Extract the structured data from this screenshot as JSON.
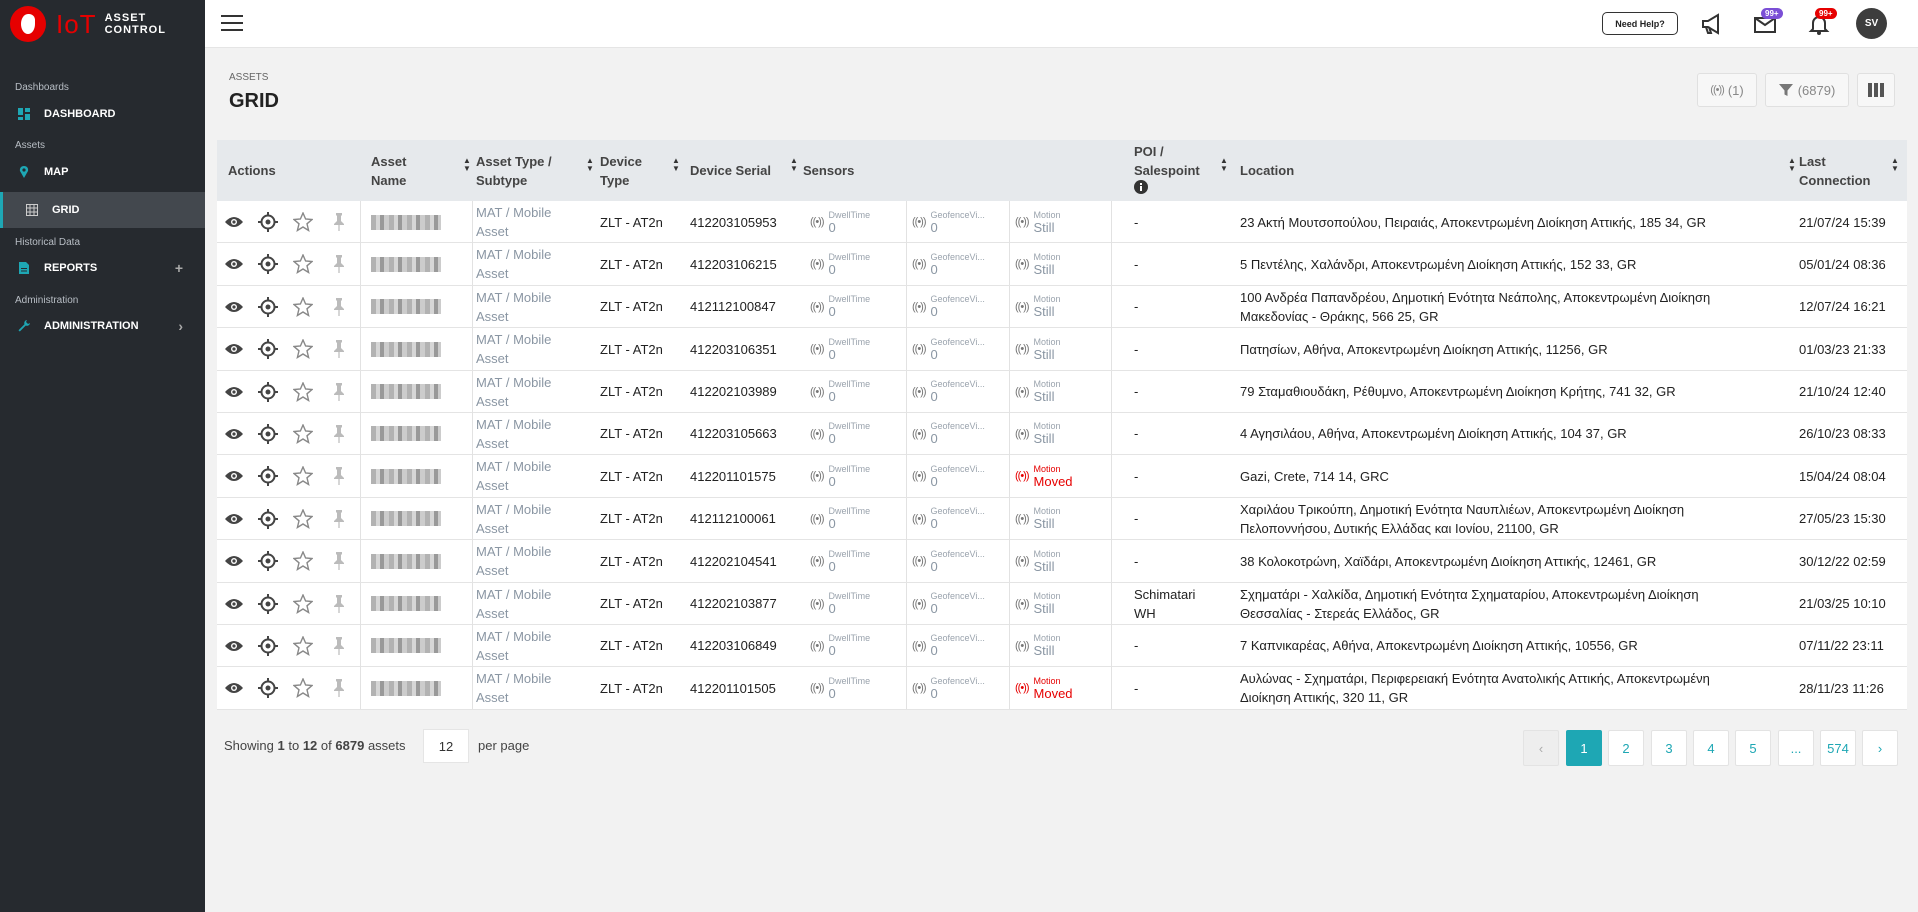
{
  "brand": {
    "iot": "IoT",
    "asset": "ASSET",
    "control": "CONTROL"
  },
  "sidebar": {
    "sections": [
      "Dashboards",
      "Assets",
      "Historical Data",
      "Administration"
    ],
    "items": [
      {
        "label": "DASHBOARD",
        "icon": "dashboard-icon"
      },
      {
        "label": "MAP",
        "icon": "map-pin-icon"
      },
      {
        "label": "GRID",
        "icon": "grid-icon"
      },
      {
        "label": "REPORTS",
        "icon": "report-icon",
        "trail": "+"
      },
      {
        "label": "ADMINISTRATION",
        "icon": "wrench-icon",
        "trail": "›"
      }
    ]
  },
  "topbar": {
    "need_help": "Need Help?",
    "mail_badge": "99+",
    "bell_badge": "99+",
    "avatar": "SV"
  },
  "page": {
    "breadcrumb": "ASSETS",
    "title": "GRID",
    "sensor_count": "(1)",
    "filter_count": "(6879)"
  },
  "columns": {
    "actions": "Actions",
    "asset_name_1": "Asset",
    "asset_name_2": "Name",
    "asset_type_1": "Asset Type /",
    "asset_type_2": "Subtype",
    "device_type_1": "Device",
    "device_type_2": "Type",
    "device_serial": "Device Serial",
    "sensors": "Sensors",
    "poi_1": "POI /",
    "poi_2": "Salespoint",
    "location": "Location",
    "last_conn_1": "Last",
    "last_conn_2": "Connection"
  },
  "rows": [
    {
      "type1": "MAT / Mobile",
      "type2": "Asset",
      "device": "ZLT - AT2n",
      "serial": "412203105953",
      "dwell_label": "DwellTime",
      "dwell": "0",
      "geo_label": "GeofenceVi...",
      "geo": "0",
      "motion_label": "Motion",
      "motion": "Still",
      "poi1": "-",
      "poi2": "",
      "loc1": "23 Ακτή Μουτσοπούλου, Πειραιάς, Αποκεντρωμένη Διοίκηση Αττικής, 185 34, GR",
      "loc2": "",
      "last": "21/07/24 15:39"
    },
    {
      "type1": "MAT / Mobile",
      "type2": "Asset",
      "device": "ZLT - AT2n",
      "serial": "412203106215",
      "dwell_label": "DwellTime",
      "dwell": "0",
      "geo_label": "GeofenceVi...",
      "geo": "0",
      "motion_label": "Motion",
      "motion": "Still",
      "poi1": "-",
      "poi2": "",
      "loc1": "5 Πεντέλης, Χαλάνδρι, Αποκεντρωμένη Διοίκηση Αττικής, 152 33, GR",
      "loc2": "",
      "last": "05/01/24 08:36"
    },
    {
      "type1": "MAT / Mobile",
      "type2": "Asset",
      "device": "ZLT - AT2n",
      "serial": "412112100847",
      "dwell_label": "DwellTime",
      "dwell": "0",
      "geo_label": "GeofenceVi...",
      "geo": "0",
      "motion_label": "Motion",
      "motion": "Still",
      "poi1": "-",
      "poi2": "",
      "loc1": "100 Ανδρέα Παπανδρέου, Δημοτική Ενότητα Νεάπολης, Αποκεντρωμένη Διοίκηση",
      "loc2": "Μακεδονίας - Θράκης, 566 25, GR",
      "last": "12/07/24 16:21"
    },
    {
      "type1": "MAT / Mobile",
      "type2": "Asset",
      "device": "ZLT - AT2n",
      "serial": "412203106351",
      "dwell_label": "DwellTime",
      "dwell": "0",
      "geo_label": "GeofenceVi...",
      "geo": "0",
      "motion_label": "Motion",
      "motion": "Still",
      "poi1": "-",
      "poi2": "",
      "loc1": "Πατησίων, Αθήνα, Αποκεντρωμένη Διοίκηση Αττικής, 11256, GR",
      "loc2": "",
      "last": "01/03/23 21:33"
    },
    {
      "type1": "MAT / Mobile",
      "type2": "Asset",
      "device": "ZLT - AT2n",
      "serial": "412202103989",
      "dwell_label": "DwellTime",
      "dwell": "0",
      "geo_label": "GeofenceVi...",
      "geo": "0",
      "motion_label": "Motion",
      "motion": "Still",
      "poi1": "-",
      "poi2": "",
      "loc1": "79 Σταμαθιουδάκη, Ρέθυμνο, Αποκεντρωμένη Διοίκηση Κρήτης, 741 32, GR",
      "loc2": "",
      "last": "21/10/24 12:40"
    },
    {
      "type1": "MAT / Mobile",
      "type2": "Asset",
      "device": "ZLT - AT2n",
      "serial": "412203105663",
      "dwell_label": "DwellTime",
      "dwell": "0",
      "geo_label": "GeofenceVi...",
      "geo": "0",
      "motion_label": "Motion",
      "motion": "Still",
      "poi1": "-",
      "poi2": "",
      "loc1": "4 Αγησιλάου, Αθήνα, Αποκεντρωμένη Διοίκηση Αττικής, 104 37, GR",
      "loc2": "",
      "last": "26/10/23 08:33"
    },
    {
      "type1": "MAT / Mobile",
      "type2": "Asset",
      "device": "ZLT - AT2n",
      "serial": "412201101575",
      "dwell_label": "DwellTime",
      "dwell": "0",
      "geo_label": "GeofenceVi...",
      "geo": "0",
      "motion_label": "Motion",
      "motion": "Moved",
      "poi1": "-",
      "poi2": "",
      "loc1": "Gazi, Crete, 714 14, GRC",
      "loc2": "",
      "last": "15/04/24 08:04"
    },
    {
      "type1": "MAT / Mobile",
      "type2": "Asset",
      "device": "ZLT - AT2n",
      "serial": "412112100061",
      "dwell_label": "DwellTime",
      "dwell": "0",
      "geo_label": "GeofenceVi...",
      "geo": "0",
      "motion_label": "Motion",
      "motion": "Still",
      "poi1": "-",
      "poi2": "",
      "loc1": "Χαριλάου Τρικούπη, Δημοτική Ενότητα Ναυπλιέων, Αποκεντρωμένη Διοίκηση",
      "loc2": "Πελοποννήσου, Δυτικής Ελλάδας και Ιονίου, 21100, GR",
      "last": "27/05/23 15:30"
    },
    {
      "type1": "MAT / Mobile",
      "type2": "Asset",
      "device": "ZLT - AT2n",
      "serial": "412202104541",
      "dwell_label": "DwellTime",
      "dwell": "0",
      "geo_label": "GeofenceVi...",
      "geo": "0",
      "motion_label": "Motion",
      "motion": "Still",
      "poi1": "-",
      "poi2": "",
      "loc1": "38 Κολοκοτρώνη, Χαϊδάρι, Αποκεντρωμένη Διοίκηση Αττικής, 12461, GR",
      "loc2": "",
      "last": "30/12/22 02:59"
    },
    {
      "type1": "MAT / Mobile",
      "type2": "Asset",
      "device": "ZLT - AT2n",
      "serial": "412202103877",
      "dwell_label": "DwellTime",
      "dwell": "0",
      "geo_label": "GeofenceVi...",
      "geo": "0",
      "motion_label": "Motion",
      "motion": "Still",
      "poi1": "Schimatari",
      "poi2": "WH",
      "loc1": "Σχηματάρι - Χαλκίδα, Δημοτική Ενότητα Σχηματαρίου, Αποκεντρωμένη Διοίκηση",
      "loc2": "Θεσσαλίας - Στερεάς Ελλάδος, GR",
      "last": "21/03/25 10:10"
    },
    {
      "type1": "MAT / Mobile",
      "type2": "Asset",
      "device": "ZLT - AT2n",
      "serial": "412203106849",
      "dwell_label": "DwellTime",
      "dwell": "0",
      "geo_label": "GeofenceVi...",
      "geo": "0",
      "motion_label": "Motion",
      "motion": "Still",
      "poi1": "-",
      "poi2": "",
      "loc1": "7 Καπνικαρέας, Αθήνα, Αποκεντρωμένη Διοίκηση Αττικής, 10556, GR",
      "loc2": "",
      "last": "07/11/22 23:11"
    },
    {
      "type1": "MAT / Mobile",
      "type2": "Asset",
      "device": "ZLT - AT2n",
      "serial": "412201101505",
      "dwell_label": "DwellTime",
      "dwell": "0",
      "geo_label": "GeofenceVi...",
      "geo": "0",
      "motion_label": "Motion",
      "motion": "Moved",
      "poi1": "-",
      "poi2": "",
      "loc1": "Αυλώνας - Σχηματάρι, Περιφερειακή Ενότητα Ανατολικής Αττικής, Αποκεντρωμένη",
      "loc2": "Διοίκηση Αττικής, 320 11, GR",
      "last": "28/11/23 11:26"
    }
  ],
  "footer": {
    "showing": "Showing",
    "from": "1",
    "to_word": "to",
    "to": "12",
    "of_word": "of",
    "total": "6879",
    "assets_word": "assets",
    "per_page_value": "12",
    "per_page_label": "per page"
  },
  "pagination": {
    "prev": "‹",
    "pages": [
      "1",
      "2",
      "3",
      "4",
      "5",
      "...",
      "574"
    ],
    "next": "›"
  },
  "colors": {
    "accent": "#1ea7b4",
    "brand_red": "#e60000",
    "sidebar_bg": "#262a2f",
    "badge_purple": "#7b4fd6"
  }
}
